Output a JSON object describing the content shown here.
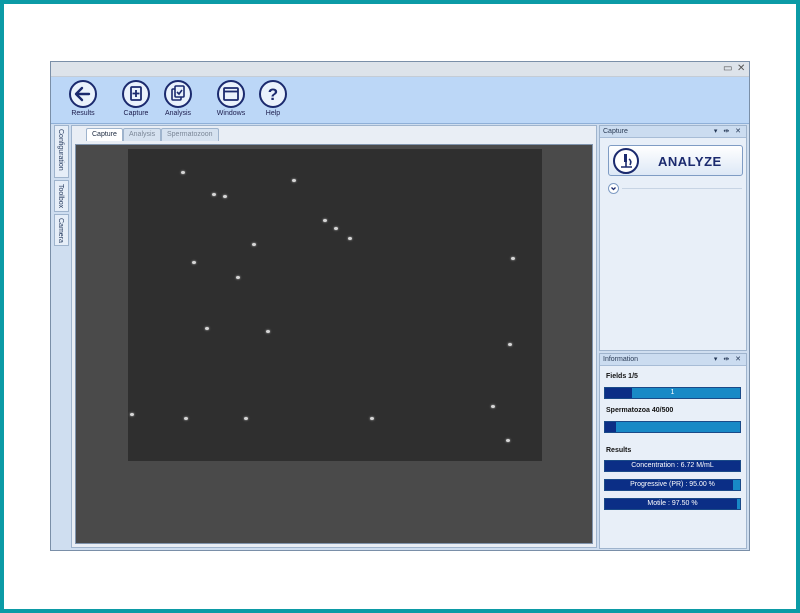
{
  "window": {
    "minimize": "▭",
    "close": "✕"
  },
  "ribbon": {
    "buttons": [
      {
        "label": "Results",
        "icon": "back-arrow-icon"
      },
      {
        "label": "Capture",
        "icon": "capture-doc-icon"
      },
      {
        "label": "Analysis",
        "icon": "analysis-doc-icon"
      },
      {
        "label": "Windows",
        "icon": "window-icon"
      },
      {
        "label": "Help",
        "icon": "help-icon"
      }
    ]
  },
  "side_tabs": [
    "Configuration",
    "Toolbox",
    "Camera"
  ],
  "doc_tabs": {
    "active": "Capture",
    "items": [
      "Capture",
      "Analysis",
      "Spermatozoon"
    ]
  },
  "capture_panel": {
    "title": "Capture",
    "controls": "▾ ⇹ ✕",
    "analyze_label": "ANALYZE",
    "analyze_icon": "microscope-icon"
  },
  "info_panel": {
    "title": "Information",
    "controls": "▾ ⇹ ✕",
    "fields": {
      "label": "Fields 1/5",
      "bar_text": "1",
      "fraction": 0.2
    },
    "spermatozoa": {
      "label": "Spermatozoa 40/500",
      "bar_text": "",
      "fraction": 0.08
    },
    "results_label": "Results",
    "results": [
      {
        "text": "Concentration : 6.72 M/mL",
        "fraction": 1.0
      },
      {
        "text": "Progressive (PR) : 95.00 %",
        "fraction": 0.95
      },
      {
        "text": "Motile : 97.50 %",
        "fraction": 0.975
      }
    ]
  },
  "colors": {
    "bar_fill": "#0b2e86",
    "bar_bg": "#1889c6",
    "frame": "#0c9ba6",
    "ribbon": "#bcd7f7"
  }
}
